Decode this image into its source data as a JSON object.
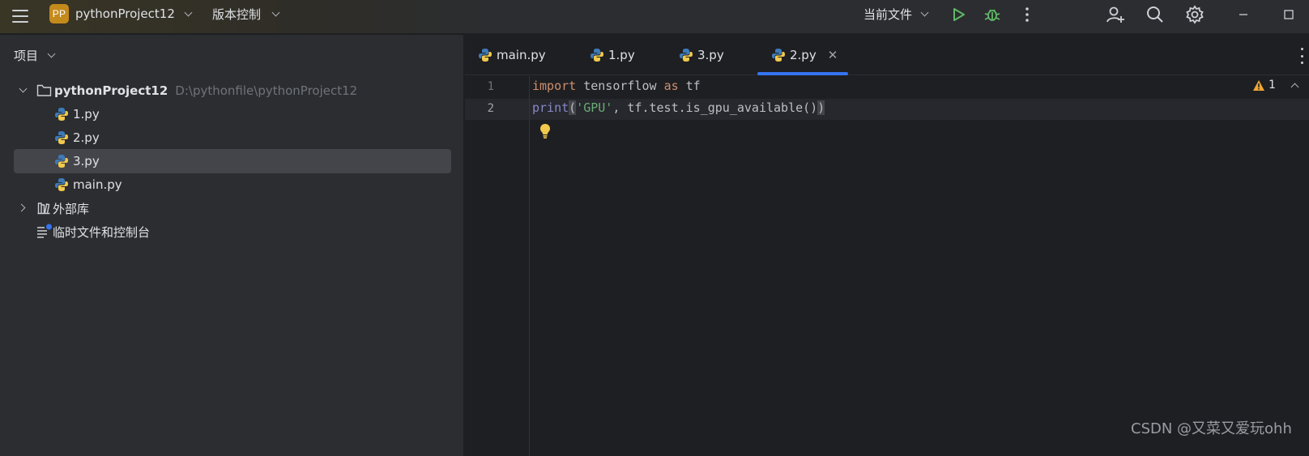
{
  "titlebar": {
    "menu_icon": "hamburger-menu-icon",
    "project_badge": "PP",
    "project_name": "pythonProject12",
    "vcs_label": "版本控制",
    "run_config": "当前文件",
    "icons": [
      "run-icon",
      "debug-icon",
      "more-vertical-icon",
      "add-user-icon",
      "search-icon",
      "settings-gear-icon",
      "minimize-icon",
      "maximize-icon"
    ],
    "colors": {
      "badge": "#c48a1c",
      "run": "#5fb865",
      "debug": "#5fb865"
    }
  },
  "project_panel": {
    "title": "项目",
    "root": {
      "name": "pythonProject12",
      "path": "D:\\pythonfile\\pythonProject12"
    },
    "files": [
      {
        "name": "1.py",
        "selected": false
      },
      {
        "name": "2.py",
        "selected": false
      },
      {
        "name": "3.py",
        "selected": true
      },
      {
        "name": "main.py",
        "selected": false
      }
    ],
    "external_libs": "外部库",
    "scratches": "临时文件和控制台"
  },
  "editor": {
    "tabs": [
      {
        "label": "main.py",
        "active": false
      },
      {
        "label": "1.py",
        "active": false
      },
      {
        "label": "3.py",
        "active": false
      },
      {
        "label": "2.py",
        "active": true
      }
    ],
    "line_numbers": [
      "1",
      "2"
    ],
    "code_lines": [
      "import tensorflow as tf",
      "print('GPU', tf.test.is_gpu_available())"
    ],
    "warning_count": "1",
    "colors": {
      "keyword": "#cf8e6d",
      "builtin": "#8888c6",
      "string": "#6aab73",
      "tab_underline": "#3574f0"
    }
  },
  "watermark": "CSDN @又菜又爱玩ohh"
}
